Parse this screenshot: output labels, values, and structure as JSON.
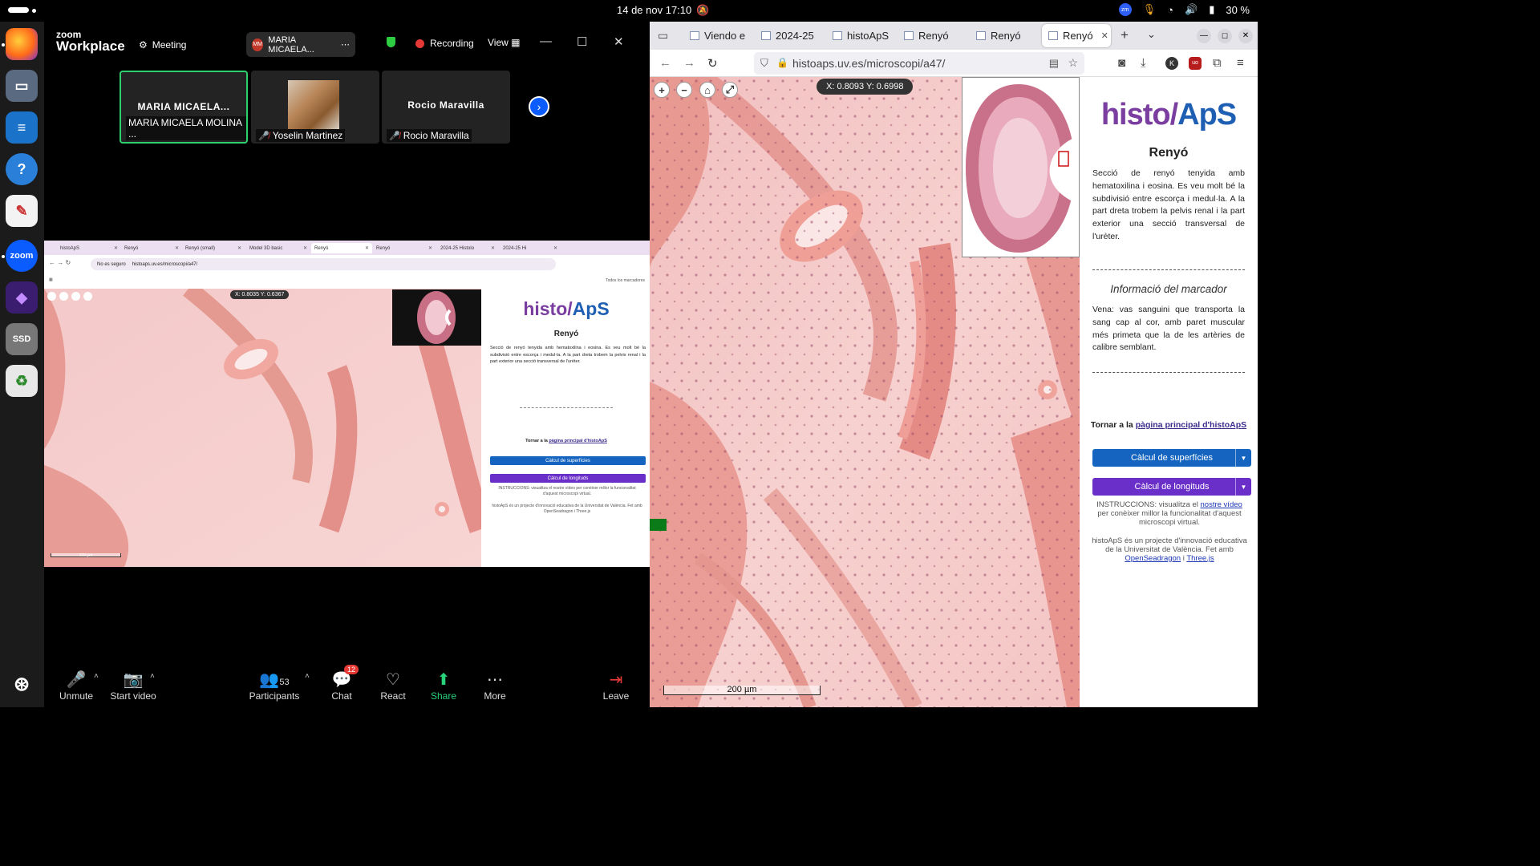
{
  "topbar": {
    "datetime": "14 de nov  17:10",
    "battery": "30 %",
    "zm_badge": "zm"
  },
  "dock": {
    "apps": [
      "Firefox",
      "Files",
      "Writer",
      "Help",
      "Text Editor",
      "Zoom",
      "App",
      "SSD",
      "Recycle"
    ],
    "ssd_label": "SSD",
    "zoom_label": "zoom"
  },
  "zoom": {
    "logo_top": "zoom",
    "logo_bottom": "Workplace",
    "meeting_label": "Meeting",
    "host_pill": {
      "initials": "MM",
      "name": "MARIA MICAELA..."
    },
    "recording_label": "Recording",
    "view_label": "View",
    "participants": [
      {
        "center": "MARIA MICAELA...",
        "name": "MARIA MICAELA MOLINA ...",
        "muted": false,
        "active": true
      },
      {
        "center": "",
        "name": "Yoselin Martinez",
        "muted": true,
        "active": false
      },
      {
        "center": "Rocio Maravilla",
        "name": "Rocio Maravilla",
        "muted": true,
        "active": false
      }
    ],
    "toolbar": {
      "unmute": "Unmute",
      "start_video": "Start video",
      "participants": "Participants",
      "participants_count": "53",
      "chat": "Chat",
      "chat_badge": "12",
      "react": "React",
      "share": "Share",
      "more": "More",
      "leave": "Leave"
    },
    "shared_screen": {
      "tabs": [
        "histoApS",
        "Renyó",
        "Renyó (small)",
        "Model 3D basic",
        "Renyó",
        "Renyó",
        "2024-25 Histolo",
        "2024-25 Hi"
      ],
      "security": "No es seguro",
      "url": "histoaps.uv.es/microscopi/a47/",
      "bookmarks": "Todos los marcadores",
      "coords": "X: 0.8035   Y: 0.6367",
      "scale": "100 µm",
      "logo_left": "histo/",
      "logo_right": "ApS",
      "title": "Renyó",
      "desc": "Secció de renyó tenyida amb hematoxilina i eosina. Es veu molt bé la subdivisió entre escorça i medul·la. A la part dreta trobem la pelvis renal i la part exterior una secció transversal de l'urèter.",
      "back_prefix": "Tornar a la ",
      "back_link": "pàgina principal d'histoApS",
      "btn_surface": "Càlcul de superfícies",
      "btn_length": "Càlcul de longituds",
      "instr": "INSTRUCCIONS: visualitza el nostre vídeo per conèixer millor la funcionalitat d'aquest microscopi virtual.",
      "credit": "histoApS és un projecte d'innovació educativa de la Universitat de València. Fet amb OpenSeadragon i Three.js"
    }
  },
  "firefox": {
    "tabs": [
      {
        "label": "Viendo e",
        "active": false
      },
      {
        "label": "2024-25",
        "active": false
      },
      {
        "label": "histoApS",
        "active": false
      },
      {
        "label": "Renyó",
        "active": false
      },
      {
        "label": "Renyó",
        "active": false
      },
      {
        "label": "Renyó",
        "active": true
      }
    ],
    "url": "histoaps.uv.es/microscopi/a47/",
    "coords": "X: 0.8093   Y: 0.6998",
    "scale": "200 µm",
    "panel": {
      "logo_left": "histo/",
      "logo_right": "ApS",
      "title": "Renyó",
      "desc": "Secció de renyó tenyida amb hematoxilina i eosina. Es veu molt bé la subdivisió entre escorça i medul·la. A la part dreta trobem la pelvis renal i la part exterior una secció transversal de l'urèter.",
      "marker_title": "Informació del marcador",
      "marker_desc": "Vena: vas sanguini que transporta la sang cap al cor, amb paret muscular més primeta que la de les artèries de calibre semblant.",
      "back_prefix": "Tornar a la ",
      "back_link": "pàgina principal d'histoApS",
      "btn_surface": "Càlcul de superfícies",
      "btn_length": "Càlcul de longituds",
      "instr_prefix": "INSTRUCCIONS: visualitza el ",
      "instr_link": "nostre vídeo",
      "instr_suffix": " per conèixer millor la funcionalitat d'aquest microscopi virtual.",
      "credit_prefix": "histoApS és un projecte d'innovació educativa de la Universitat de València. Fet amb ",
      "credit_link1": "OpenSeadragon",
      "credit_mid": " i ",
      "credit_link2": "Three.js"
    }
  },
  "colors": {
    "accent_blue": "#1565c0",
    "accent_purple": "#6a2fc8",
    "active_tile": "#2ed06e",
    "share_green": "#27d27a",
    "record_red": "#e53935"
  }
}
